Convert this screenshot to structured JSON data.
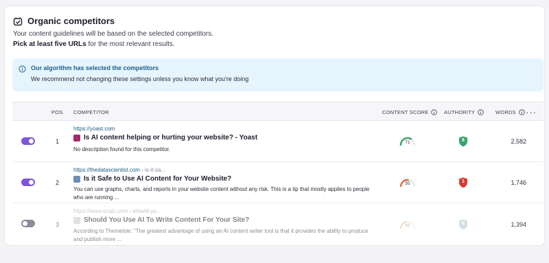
{
  "header": {
    "title": "Organic competitors",
    "subtitle": "Your content guidelines will be based on the selected competitors.",
    "subtitle2_bold": "Pick at least five URLs",
    "subtitle2_rest": " for the most relevant results."
  },
  "notice": {
    "title": "Our algorithm has selected the competitors",
    "body": "We recommend not changing these settings unless you know what you're doing"
  },
  "table": {
    "columns": {
      "pos": "POS.",
      "competitor": "COMPETITOR",
      "content_score": "CONTENT SCORE",
      "authority": "AUTHORITY",
      "words": "WORDS",
      "more": "···"
    },
    "rows": [
      {
        "enabled": true,
        "pos": "1",
        "url": "https://yoast.com",
        "url_suffix": "",
        "title": "Is AI content helping or hurting your website? - Yoast",
        "description": "No description found for this competitor.",
        "content_score": 71,
        "authority": "8",
        "authority_color": "#36a36b",
        "words": "2,582"
      },
      {
        "enabled": true,
        "pos": "2",
        "url": "https://thedatascientist.com",
        "url_suffix": " › is-it-sa...",
        "title": "Is it Safe to Use AI Content for Your Website?",
        "description": "You can use graphs, charts, and reports in your website content without any risk. This is a tip that mostly applies to people who are running ...",
        "content_score": 55,
        "authority": "1",
        "authority_color": "#d93b35",
        "words": "1,746"
      },
      {
        "enabled": false,
        "pos": "3",
        "url": "https://www.ezaic.com",
        "url_suffix": " › should-yo...",
        "title": "Should You Use AI To Write Content For Your Site?",
        "description": "According to Themelsle: \"The greatest advantage of using an AI content writer tool is that it provides the ability to produce and publish more ...",
        "content_score": 42,
        "authority": "6",
        "authority_color": "#7fa7b8",
        "words": "1,394"
      }
    ]
  },
  "colors": {
    "accent": "#7d55d9",
    "notice_bg": "#e6f4fd",
    "score_green": "#36a36b",
    "score_orange": "#e06c3a",
    "score_light": "#e8c9a0"
  }
}
